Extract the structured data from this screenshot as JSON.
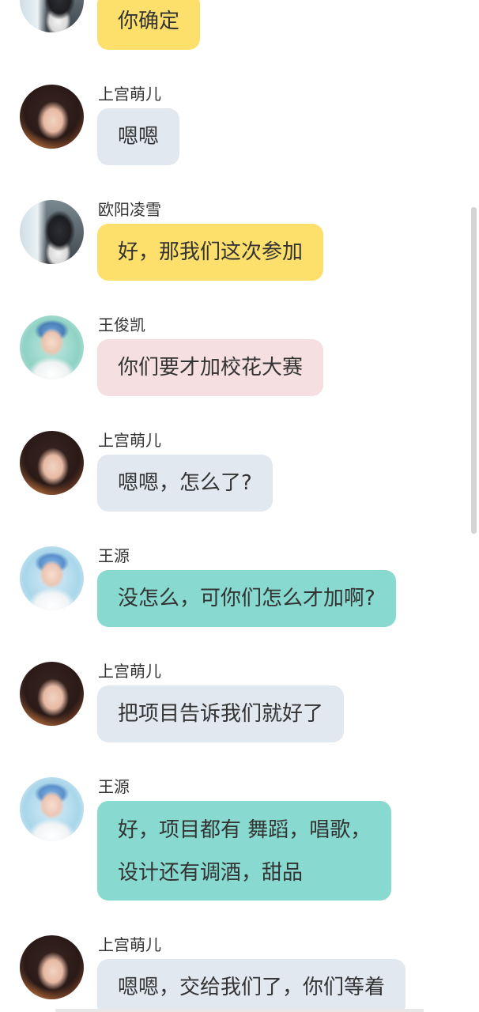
{
  "colors": {
    "yellow_bubble": "#fddf6c",
    "gray_bubble": "#e2e8f0",
    "pink_bubble": "#f5dfe0",
    "teal_bubble": "#88d9cf"
  },
  "messages": [
    {
      "name": "",
      "text": "你确定",
      "avatar": "dark-haired-girl-avatar",
      "color": "#fddf6c"
    },
    {
      "name": "上宫萌儿",
      "text": "嗯嗯",
      "avatar": "girl-portrait-avatar",
      "color": "#e2e8f0"
    },
    {
      "name": "欧阳凌雪",
      "text": "好，那我们这次参加",
      "avatar": "dark-haired-girl-avatar",
      "color": "#fddf6c"
    },
    {
      "name": "王俊凯",
      "text": "你们要才加校花大赛",
      "avatar": "boy-portrait-avatar",
      "color": "#f5dfe0"
    },
    {
      "name": "上宫萌儿",
      "text": "嗯嗯，怎么了?",
      "avatar": "girl-portrait-avatar",
      "color": "#e2e8f0"
    },
    {
      "name": "王源",
      "text": "没怎么，可你们怎么才加啊?",
      "avatar": "boy-portrait-avatar",
      "color": "#88d9cf"
    },
    {
      "name": "上宫萌儿",
      "text": "把项目告诉我们就好了",
      "avatar": "girl-portrait-avatar",
      "color": "#e2e8f0"
    },
    {
      "name": "王源",
      "text_line1": "好，项目都有  舞蹈，唱歌，",
      "text_line2": "设计还有调酒，甜品",
      "avatar": "boy-portrait-avatar",
      "color": "#88d9cf"
    },
    {
      "name": "上宫萌儿",
      "text": "嗯嗯，交给我们了，你们等着",
      "avatar": "girl-portrait-avatar",
      "color": "#e2e8f0"
    }
  ]
}
